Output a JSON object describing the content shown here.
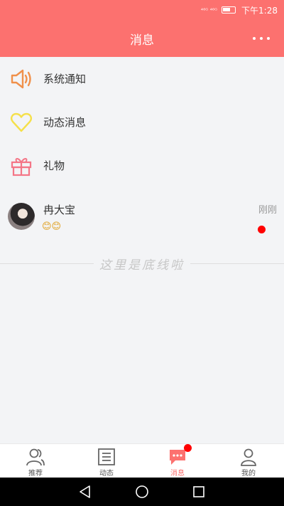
{
  "status_bar": {
    "time": "下午1:28",
    "indicators": "⁴⁶ᴳ ⁴⁶ᴳ"
  },
  "header": {
    "title": "消息",
    "more_icon": "more-icon"
  },
  "menu": [
    {
      "label": "系统通知",
      "icon": "speaker-icon",
      "color": "#f0904a"
    },
    {
      "label": "动态消息",
      "icon": "heart-icon",
      "color": "#f5e04a"
    },
    {
      "label": "礼物",
      "icon": "gift-icon",
      "color": "#f47687"
    }
  ],
  "conversation": {
    "name": "冉大宝",
    "time": "刚刚",
    "preview": "😊😊",
    "unread": true
  },
  "end_text": "这里是底线啦",
  "tabs": [
    {
      "label": "推荐",
      "icon": "people-icon",
      "active": false
    },
    {
      "label": "动态",
      "icon": "feed-icon",
      "active": false
    },
    {
      "label": "消息",
      "icon": "chat-icon",
      "active": true,
      "badge": true
    },
    {
      "label": "我的",
      "icon": "profile-icon",
      "active": false
    }
  ],
  "colors": {
    "accent": "#fc716f",
    "unread": "#ff0000"
  }
}
